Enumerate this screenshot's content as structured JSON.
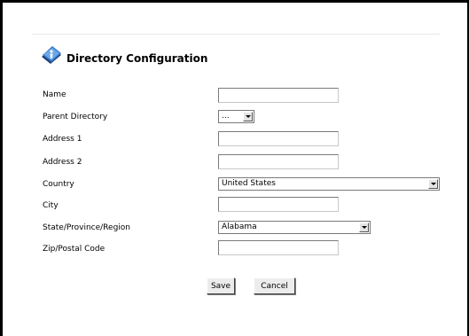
{
  "header": {
    "title": "Directory Configuration",
    "icon": "info-book-icon"
  },
  "fields": {
    "name": {
      "label": "Name",
      "value": ""
    },
    "parent_directory": {
      "label": "Parent Directory",
      "value": "..."
    },
    "address1": {
      "label": "Address 1",
      "value": ""
    },
    "address2": {
      "label": "Address 2",
      "value": ""
    },
    "country": {
      "label": "Country",
      "value": "United States"
    },
    "city": {
      "label": "City",
      "value": ""
    },
    "state": {
      "label": "State/Province/Region",
      "value": "Alabama"
    },
    "zip": {
      "label": "Zip/Postal Code",
      "value": ""
    }
  },
  "buttons": {
    "save": "Save",
    "cancel": "Cancel"
  }
}
